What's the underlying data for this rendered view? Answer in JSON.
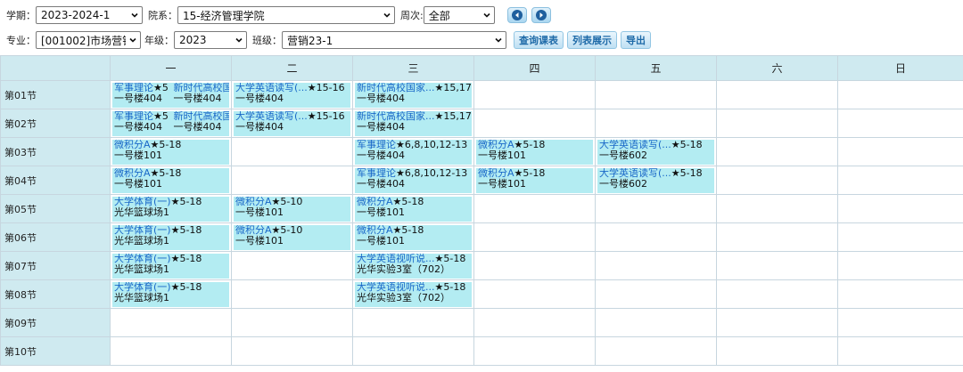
{
  "filters": {
    "term_label": "学期：",
    "term_value": "2023-2024-1",
    "dept_label": "院系：",
    "dept_value": "15-经济管理学院",
    "week_label": "周次:",
    "week_value": "全部",
    "major_label": "专业：",
    "major_value": "[001002]市场营销",
    "grade_label": "年级：",
    "grade_value": "2023",
    "class_label": "班级：",
    "class_value": "营销23-1"
  },
  "buttons": {
    "query": "查询课表",
    "list": "列表展示",
    "export": "导出"
  },
  "nav_icons": [
    "prev-week-icon",
    "next-week-icon"
  ],
  "colors": {
    "header_bg": "#cfeaf0",
    "entry_bg": "#b3ecf2",
    "link": "#1a68c8",
    "button_text": "#1e6aa8"
  },
  "days": [
    "一",
    "二",
    "三",
    "四",
    "五",
    "六",
    "日"
  ],
  "periods": [
    "第01节",
    "第02节",
    "第03节",
    "第04节",
    "第05节",
    "第06节",
    "第07节",
    "第08节",
    "第09节",
    "第10节"
  ],
  "schedule": {
    "p1": {
      "mon_a": {
        "title": "军事理论",
        "weeks": "★5",
        "room": "一号楼404"
      },
      "mon_b": {
        "title": "新时代高校国",
        "weeks": "",
        "room": "一号楼404"
      },
      "tue": {
        "title": "大学英语读写(...",
        "weeks": "★15-16",
        "room": "一号楼404"
      },
      "wed": {
        "title": "新时代高校国家...",
        "weeks": "★15,17",
        "room": "一号楼404"
      }
    },
    "p2": {
      "mon_a": {
        "title": "军事理论",
        "weeks": "★5",
        "room": "一号楼404"
      },
      "mon_b": {
        "title": "新时代高校国",
        "weeks": "",
        "room": "一号楼404"
      },
      "tue": {
        "title": "大学英语读写(...",
        "weeks": "★15-16",
        "room": "一号楼404"
      },
      "wed": {
        "title": "新时代高校国家...",
        "weeks": "★15,17",
        "room": "一号楼404"
      }
    },
    "p3": {
      "mon": {
        "title": "微积分A",
        "weeks": "★5-18",
        "room": "一号楼101"
      },
      "wed": {
        "title": "军事理论",
        "weeks": "★6,8,10,12-13",
        "room": "一号楼404"
      },
      "thu": {
        "title": "微积分A",
        "weeks": "★5-18",
        "room": "一号楼101"
      },
      "fri": {
        "title": "大学英语读写(...",
        "weeks": "★5-18",
        "room": "一号楼602"
      }
    },
    "p4": {
      "mon": {
        "title": "微积分A",
        "weeks": "★5-18",
        "room": "一号楼101"
      },
      "wed": {
        "title": "军事理论",
        "weeks": "★6,8,10,12-13",
        "room": "一号楼404"
      },
      "thu": {
        "title": "微积分A",
        "weeks": "★5-18",
        "room": "一号楼101"
      },
      "fri": {
        "title": "大学英语读写(...",
        "weeks": "★5-18",
        "room": "一号楼602"
      }
    },
    "p5": {
      "mon": {
        "title": "大学体育(一)",
        "weeks": "★5-18",
        "room": "光华篮球场1"
      },
      "tue": {
        "title": "微积分A",
        "weeks": "★5-10",
        "room": "一号楼101"
      },
      "wed": {
        "title": "微积分A",
        "weeks": "★5-18",
        "room": "一号楼101"
      }
    },
    "p6": {
      "mon": {
        "title": "大学体育(一)",
        "weeks": "★5-18",
        "room": "光华篮球场1"
      },
      "tue": {
        "title": "微积分A",
        "weeks": "★5-10",
        "room": "一号楼101"
      },
      "wed": {
        "title": "微积分A",
        "weeks": "★5-18",
        "room": "一号楼101"
      }
    },
    "p7": {
      "mon": {
        "title": "大学体育(一)",
        "weeks": "★5-18",
        "room": "光华篮球场1"
      },
      "wed": {
        "title": "大学英语视听说...",
        "weeks": "★5-18",
        "room": "光华实验3室（702）"
      }
    },
    "p8": {
      "mon": {
        "title": "大学体育(一)",
        "weeks": "★5-18",
        "room": "光华篮球场1"
      },
      "wed": {
        "title": "大学英语视听说...",
        "weeks": "★5-18",
        "room": "光华实验3室（702）"
      }
    }
  }
}
